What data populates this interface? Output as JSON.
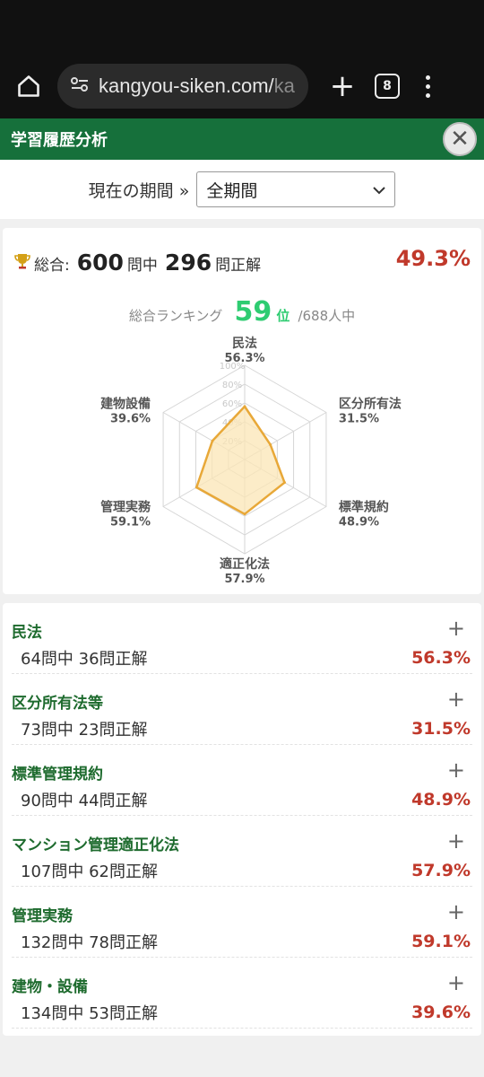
{
  "browser": {
    "url_main": "kangyou-siken.com/",
    "url_rest": "kako",
    "tab_count": "8"
  },
  "header": {
    "title": "学習履歴分析"
  },
  "period": {
    "label": "現在の期間 »",
    "selected": "全期間"
  },
  "summary": {
    "total_label": "総合:",
    "total_questions": "600",
    "mid_unit": "問中",
    "correct": "296",
    "end_unit": "問正解",
    "percent": "49.3%",
    "ranking_label": "総合ランキング",
    "rank": "59",
    "rank_suffix": "位",
    "rank_total": "/688人中"
  },
  "chart_data": {
    "type": "radar",
    "axis_ticks": [
      "20%",
      "40%",
      "60%",
      "80%",
      "100%"
    ],
    "categories": [
      "民法",
      "区分所有法",
      "標準規約",
      "適正化法",
      "管理実務",
      "建物設備"
    ],
    "values": [
      56.3,
      31.5,
      48.9,
      57.9,
      59.1,
      39.6
    ],
    "value_labels": [
      "56.3%",
      "31.5%",
      "48.9%",
      "57.9%",
      "59.1%",
      "39.6%"
    ],
    "ylim": [
      0,
      100
    ],
    "colors": {
      "line": "#e8a838",
      "fill": "#fbe6b6",
      "grid": "#d6d6d6"
    }
  },
  "categories": [
    {
      "name": "民法",
      "count": "64問中 36問正解",
      "percent": "56.3%"
    },
    {
      "name": "区分所有法等",
      "count": "73問中 23問正解",
      "percent": "31.5%"
    },
    {
      "name": "標準管理規約",
      "count": "90問中 44問正解",
      "percent": "48.9%"
    },
    {
      "name": "マンション管理適正化法",
      "count": "107問中 62問正解",
      "percent": "57.9%"
    },
    {
      "name": "管理実務",
      "count": "132問中 78問正解",
      "percent": "59.1%"
    },
    {
      "name": "建物・設備",
      "count": "134問中 53問正解",
      "percent": "39.6%"
    }
  ],
  "icons": {
    "expand": "+",
    "close": "✕"
  }
}
